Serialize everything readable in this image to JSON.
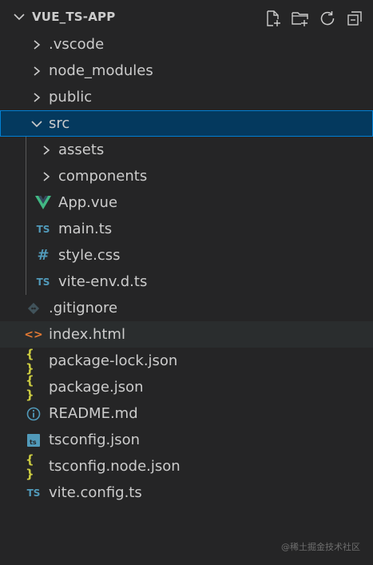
{
  "explorer": {
    "title": "VUE_TS-APP",
    "actions": [
      {
        "name": "new-file-icon"
      },
      {
        "name": "new-folder-icon"
      },
      {
        "name": "refresh-icon"
      },
      {
        "name": "collapse-all-icon"
      }
    ],
    "items": [
      {
        "label": ".vscode",
        "type": "folder",
        "depth": 0,
        "expanded": false
      },
      {
        "label": "node_modules",
        "type": "folder",
        "depth": 0,
        "expanded": false
      },
      {
        "label": "public",
        "type": "folder",
        "depth": 0,
        "expanded": false
      },
      {
        "label": "src",
        "type": "folder",
        "depth": 0,
        "expanded": true,
        "selected": true
      },
      {
        "label": "assets",
        "type": "folder",
        "depth": 1,
        "expanded": false
      },
      {
        "label": "components",
        "type": "folder",
        "depth": 1,
        "expanded": false
      },
      {
        "label": "App.vue",
        "type": "file",
        "depth": 1,
        "icon": "vue-icon"
      },
      {
        "label": "main.ts",
        "type": "file",
        "depth": 1,
        "icon": "typescript-icon"
      },
      {
        "label": "style.css",
        "type": "file",
        "depth": 1,
        "icon": "css-icon"
      },
      {
        "label": "vite-env.d.ts",
        "type": "file",
        "depth": 1,
        "icon": "typescript-icon"
      },
      {
        "label": ".gitignore",
        "type": "file",
        "depth": 0,
        "icon": "git-icon"
      },
      {
        "label": "index.html",
        "type": "file",
        "depth": 0,
        "icon": "html-icon",
        "hover": true
      },
      {
        "label": "package-lock.json",
        "type": "file",
        "depth": 0,
        "icon": "json-icon"
      },
      {
        "label": "package.json",
        "type": "file",
        "depth": 0,
        "icon": "json-icon"
      },
      {
        "label": "README.md",
        "type": "file",
        "depth": 0,
        "icon": "info-icon"
      },
      {
        "label": "tsconfig.json",
        "type": "file",
        "depth": 0,
        "icon": "tsconfig-icon"
      },
      {
        "label": "tsconfig.node.json",
        "type": "file",
        "depth": 0,
        "icon": "json-icon"
      },
      {
        "label": "vite.config.ts",
        "type": "file",
        "depth": 0,
        "icon": "typescript-icon"
      }
    ]
  },
  "watermark": "@稀土掘金技术社区",
  "colors": {
    "background": "#252526",
    "selected": "#04395e",
    "selected_border": "#007fd4",
    "text": "#cccccc",
    "vue": "#41b883",
    "typescript": "#519aba",
    "json": "#cbcb41",
    "html": "#e37933",
    "git": "#41535b"
  }
}
